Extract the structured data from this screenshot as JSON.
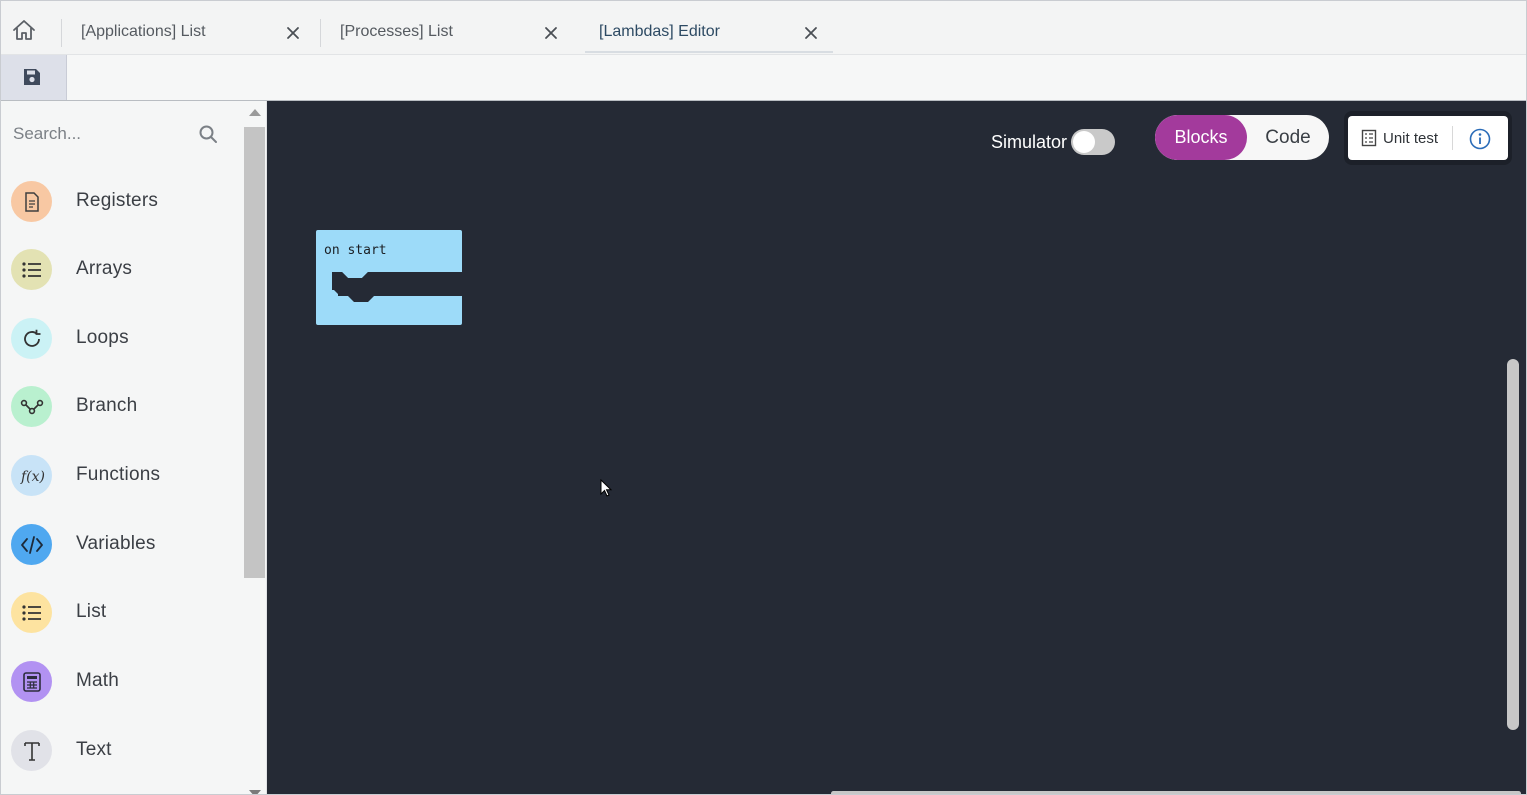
{
  "tabs": [
    {
      "label": "[Applications] List",
      "active": false
    },
    {
      "label": "[Processes] List",
      "active": false
    },
    {
      "label": "[Lambdas] Editor",
      "active": true
    }
  ],
  "toolbar": {
    "save_icon": "save-icon"
  },
  "sidebar": {
    "search": {
      "placeholder": "Search..."
    },
    "categories": [
      {
        "label": "Registers",
        "icon": "document-icon",
        "color": "#f8c8a3"
      },
      {
        "label": "Arrays",
        "icon": "list-icon",
        "color": "#e3e2b3"
      },
      {
        "label": "Loops",
        "icon": "loop-icon",
        "color": "#cbf2f5"
      },
      {
        "label": "Branch",
        "icon": "branch-icon",
        "color": "#b9f0cf"
      },
      {
        "label": "Functions",
        "icon": "function-icon",
        "color": "#c8e3f7"
      },
      {
        "label": "Variables",
        "icon": "code-icon",
        "color": "#4fa8f0"
      },
      {
        "label": "List",
        "icon": "list-icon",
        "color": "#fde3a0"
      },
      {
        "label": "Math",
        "icon": "calculator-icon",
        "color": "#b292f2"
      },
      {
        "label": "Text",
        "icon": "text-icon",
        "color": "#e1e2e8"
      }
    ]
  },
  "workspace": {
    "simulator_label": "Simulator",
    "simulator_on": false,
    "mode": {
      "blocks_label": "Blocks",
      "code_label": "Code",
      "selected": "Blocks"
    },
    "unit_test_label": "Unit test",
    "block": {
      "label": "on start",
      "color": "#9ddbf9"
    },
    "background": "#252a35",
    "accent": "#a33a9c"
  }
}
